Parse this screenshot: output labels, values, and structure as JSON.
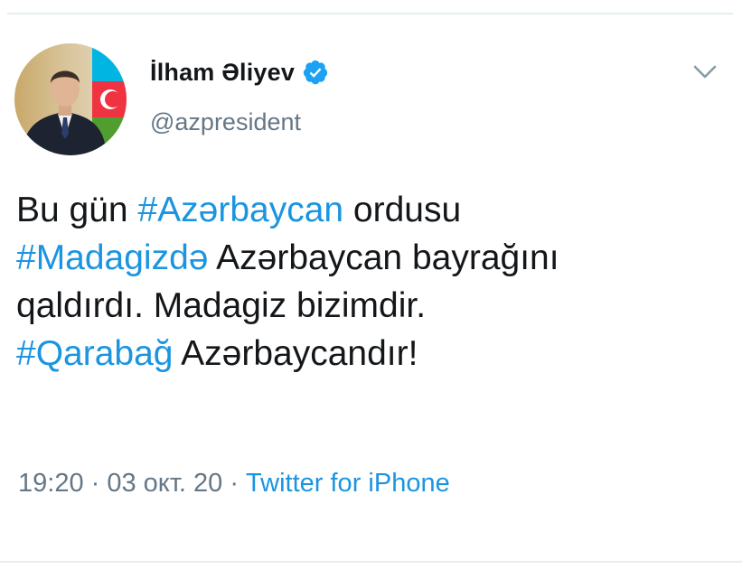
{
  "tweet": {
    "author": {
      "display_name": "İlham Əliyev",
      "handle": "@azpresident",
      "verified": true
    },
    "icons": {
      "verified": "verified-badge-icon",
      "more": "chevron-down-icon",
      "avatar": "profile-photo"
    },
    "text": {
      "p1": "Bu gün ",
      "h1": "#Azərbaycan",
      "p2": " ordusu",
      "h2": "#Madagizdə",
      "p3": " Azərbaycan bayrağını",
      "p4": "qaldırdı. Madagiz bizimdir.",
      "h3": "#Qarabağ",
      "p5": " Azərbaycandır!"
    },
    "meta": {
      "time": "19:20",
      "sep1": " · ",
      "date": "03 окт. 20",
      "sep2": " · ",
      "source": "Twitter for iPhone"
    },
    "colors": {
      "link": "#1b95e0",
      "text": "#14171a",
      "muted": "#657786"
    }
  }
}
